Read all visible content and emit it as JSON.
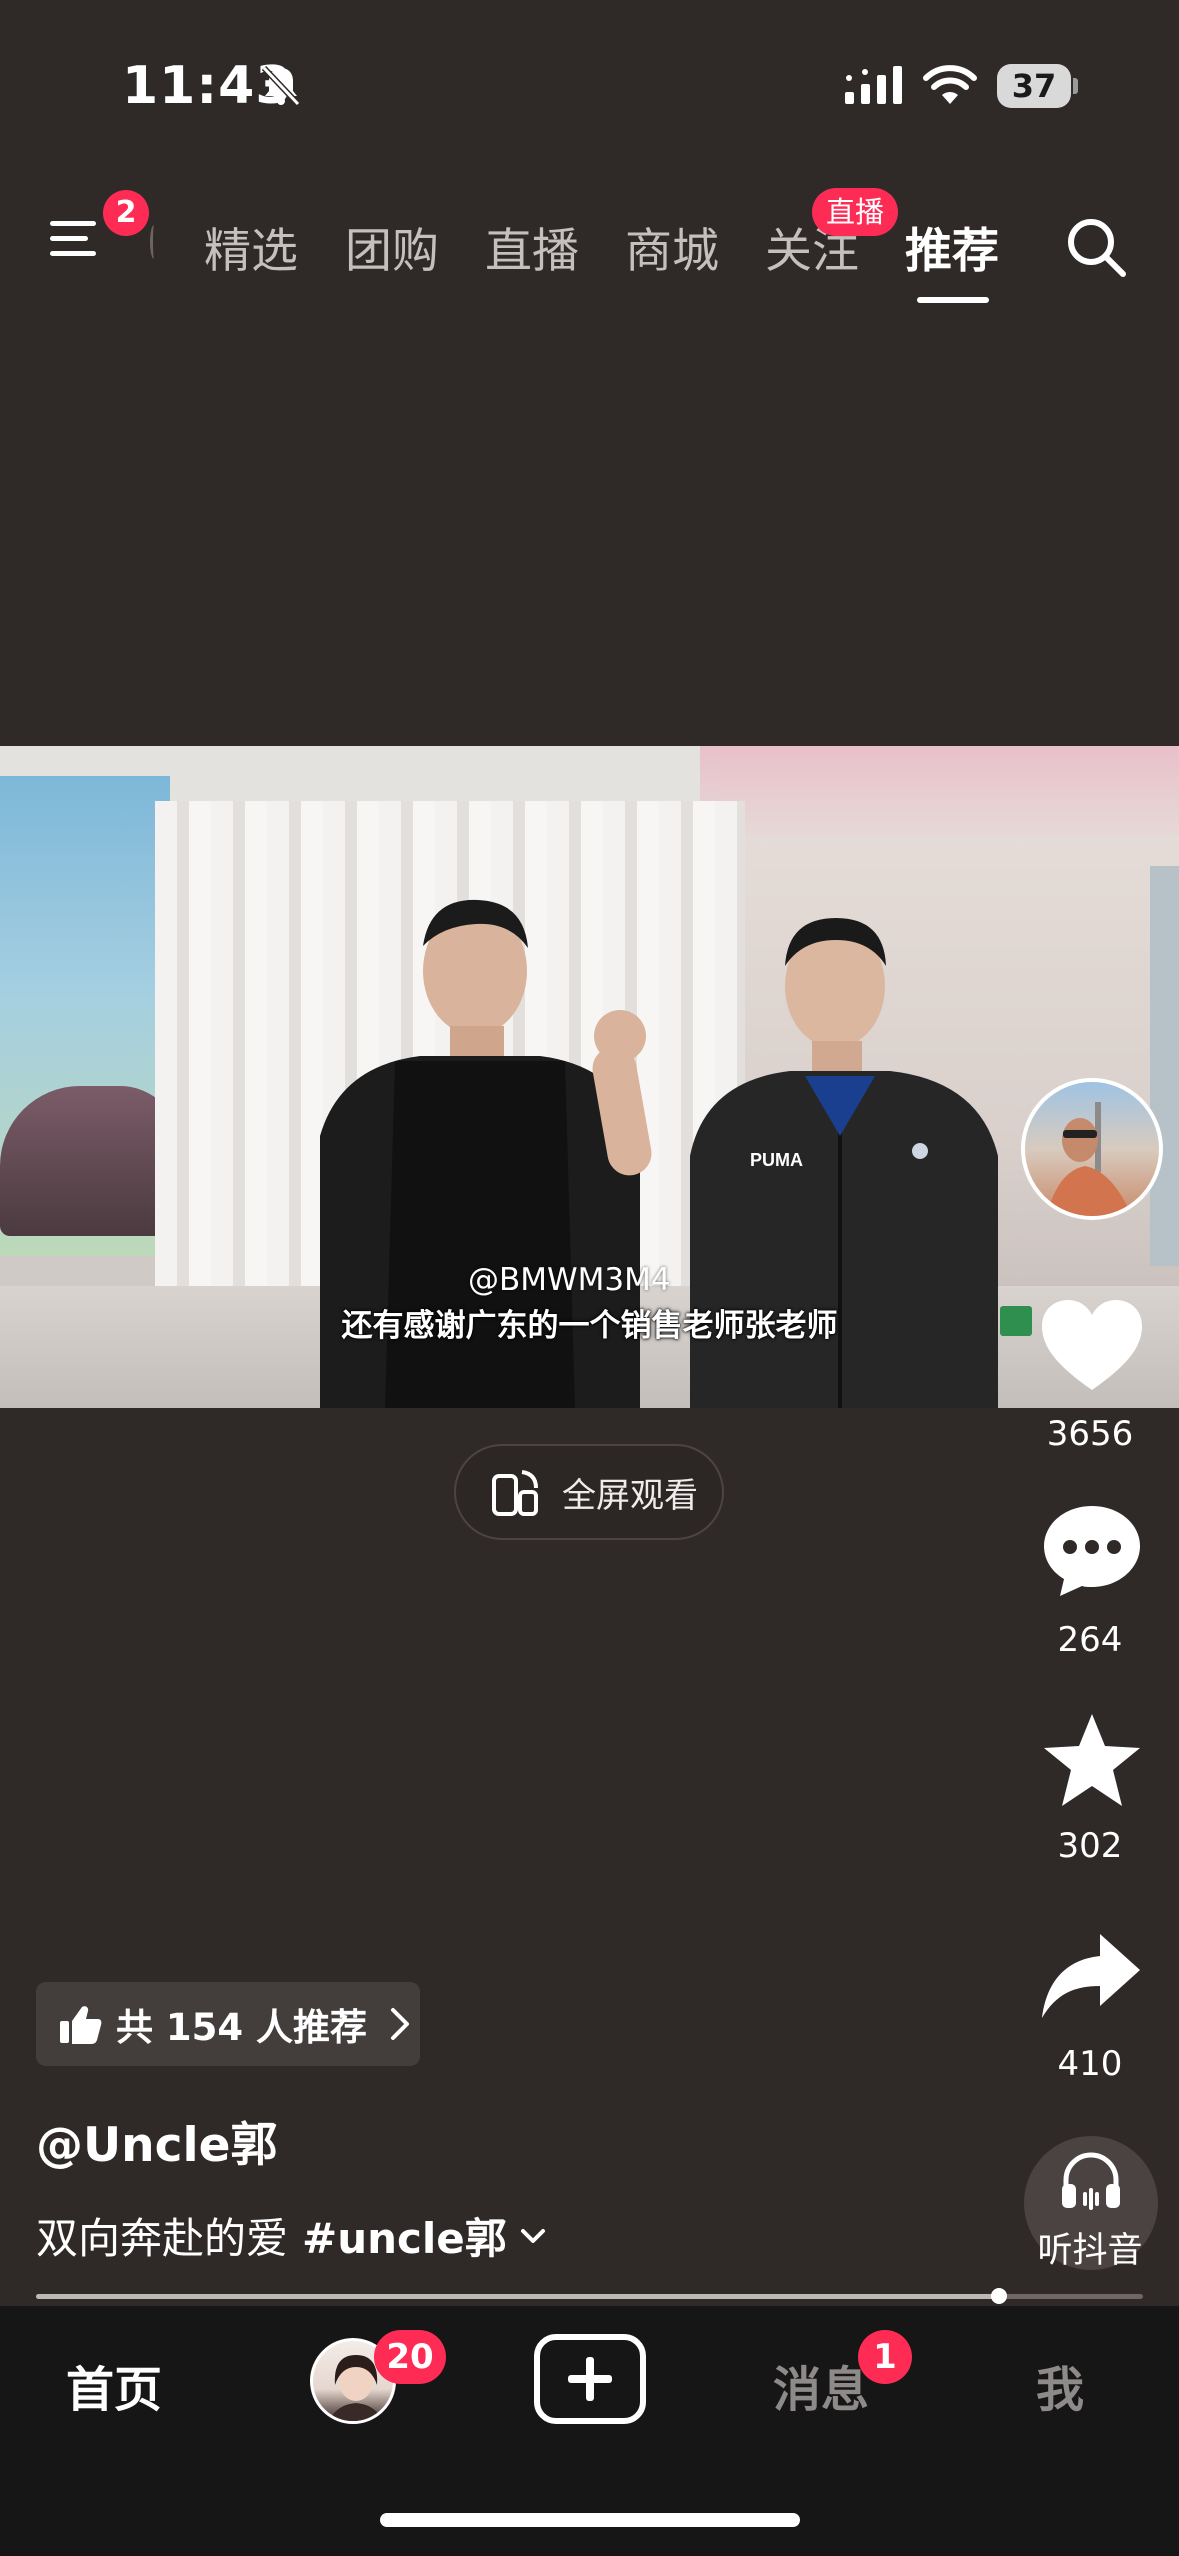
{
  "status_bar": {
    "time": "11:43",
    "battery": "37",
    "icons": [
      "bell-slash-icon",
      "signal-icon",
      "wifi-icon",
      "battery-icon"
    ]
  },
  "top_nav": {
    "menu_badge": "2",
    "tabs": [
      {
        "label": "精选"
      },
      {
        "label": "团购"
      },
      {
        "label": "直播"
      },
      {
        "label": "商城"
      },
      {
        "label": "关注"
      },
      {
        "label": "推荐"
      }
    ],
    "active_tab": "推荐",
    "live_badge": "直播"
  },
  "video": {
    "watermark": "@BMWM3M4",
    "subtitle": "还有感谢广东的一个销售老师张老师"
  },
  "fullscreen_button": {
    "label": "全屏观看"
  },
  "actions": {
    "likes": "3656",
    "comments": "264",
    "favorites": "302",
    "shares": "410",
    "listen_label": "听抖音"
  },
  "recommend_chip": {
    "label": "共 154 人推荐"
  },
  "post": {
    "author": "@Uncle郭",
    "caption": "双向奔赴的爱",
    "hashtag": "#uncle郭"
  },
  "progress": {
    "fraction": 0.87
  },
  "bottom_tabs": {
    "home": "首页",
    "friend_badge": "20",
    "messages": "消息",
    "messages_badge": "1",
    "me": "我"
  },
  "colors": {
    "background": "#2f2928",
    "accent": "#fe2c55",
    "tabbar": "#161616"
  }
}
